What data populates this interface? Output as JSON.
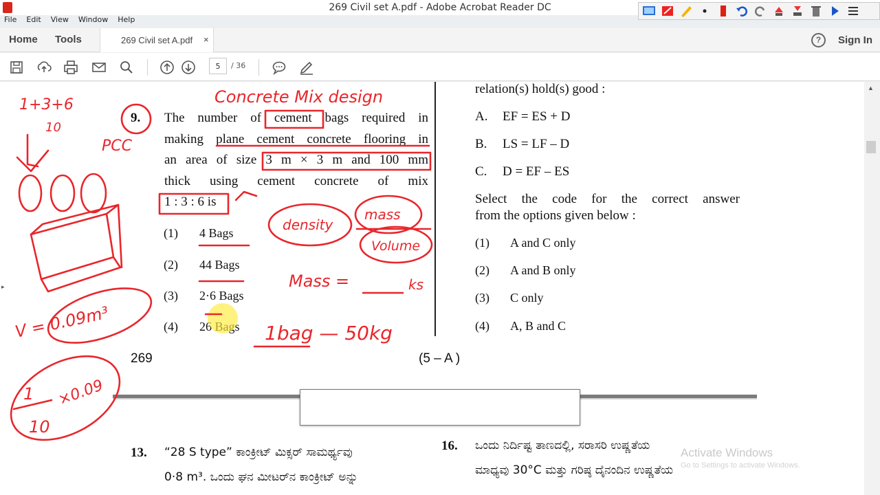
{
  "window": {
    "title": "269 Civil set A.pdf - Adobe Acrobat Reader DC"
  },
  "menu": [
    "File",
    "Edit",
    "View",
    "Window",
    "Help"
  ],
  "tabs": {
    "home": "Home",
    "tools": "Tools",
    "doc": "269 Civil set A.pdf",
    "close": "×"
  },
  "header": {
    "help": "?",
    "sign_in": "Sign In"
  },
  "toolbar": {
    "page_current": "5",
    "page_total": "/ 36"
  },
  "page": {
    "q9": {
      "number": "9.",
      "lines": [
        "The number of cement bags required in",
        "making plane cement concrete flooring in",
        "an area of size 3 m × 3 m and 100 mm",
        "thick using cement concrete of mix",
        "1 : 3 : 6 is"
      ],
      "options": [
        {
          "num": "(1)",
          "text": "4 Bags"
        },
        {
          "num": "(2)",
          "text": "44 Bags"
        },
        {
          "num": "(3)",
          "text": "2·6 Bags"
        },
        {
          "num": "(4)",
          "text": "26 Bags"
        }
      ]
    },
    "right_col": {
      "intro": "relation(s) hold(s) good :",
      "statements": [
        {
          "label": "A.",
          "text": "EF = ES + D"
        },
        {
          "label": "B.",
          "text": "LS = LF – D"
        },
        {
          "label": "C.",
          "text": "D = EF – ES"
        }
      ],
      "instruction": [
        "Select the code for the correct answer",
        "from the options given below :"
      ],
      "options": [
        {
          "num": "(1)",
          "text": "A and C only"
        },
        {
          "num": "(2)",
          "text": "A and B only"
        },
        {
          "num": "(3)",
          "text": "C only"
        },
        {
          "num": "(4)",
          "text": "A, B and C"
        }
      ]
    },
    "footer": {
      "left": "269",
      "right": "(5 – A )"
    }
  },
  "next_page": {
    "q13": {
      "number": "13.",
      "line1": "“28 S type” ಕಾಂಕ್ರೀಟ್ ಮಿಕ್ಸರ್ ಸಾಮರ್ಥ್ಯವು",
      "line2": "0·8 m³. ಒಂದು ಘನ ಮೀಟರ್‌ನ ಕಾಂಕ್ರೀಟ್ ಅನ್ನು"
    },
    "q16": {
      "number": "16.",
      "line1": "ಒಂದು ನಿರ್ದಿಷ್ಟ ತಾಣದಲ್ಲಿ, ಸರಾಸರಿ ಉಷ್ಣತೆಯ",
      "line2": "ಮಾಧ್ಯವು 30°C ಮತ್ತು ಗರಿಷ್ಠ ದೈನಂದಿನ ಉಷ್ಣತೆಯ"
    }
  },
  "ink": {
    "concrete_mix": "Concrete Mix design",
    "ratio_sum": "1+3+6",
    "ten": "10",
    "pcc": "PCC",
    "density": "density",
    "mass": "mass",
    "volume": "Volume",
    "mass_eq": "Mass =",
    "kg": "ks",
    "bag": "1bag — 50kg",
    "volume_val": "V = 0.09m³",
    "one": "1",
    "ten2": "10",
    "x009": "×0.09"
  },
  "watermark": {
    "line1": "Activate Windows",
    "line2": "Go to Settings to activate Windows."
  }
}
